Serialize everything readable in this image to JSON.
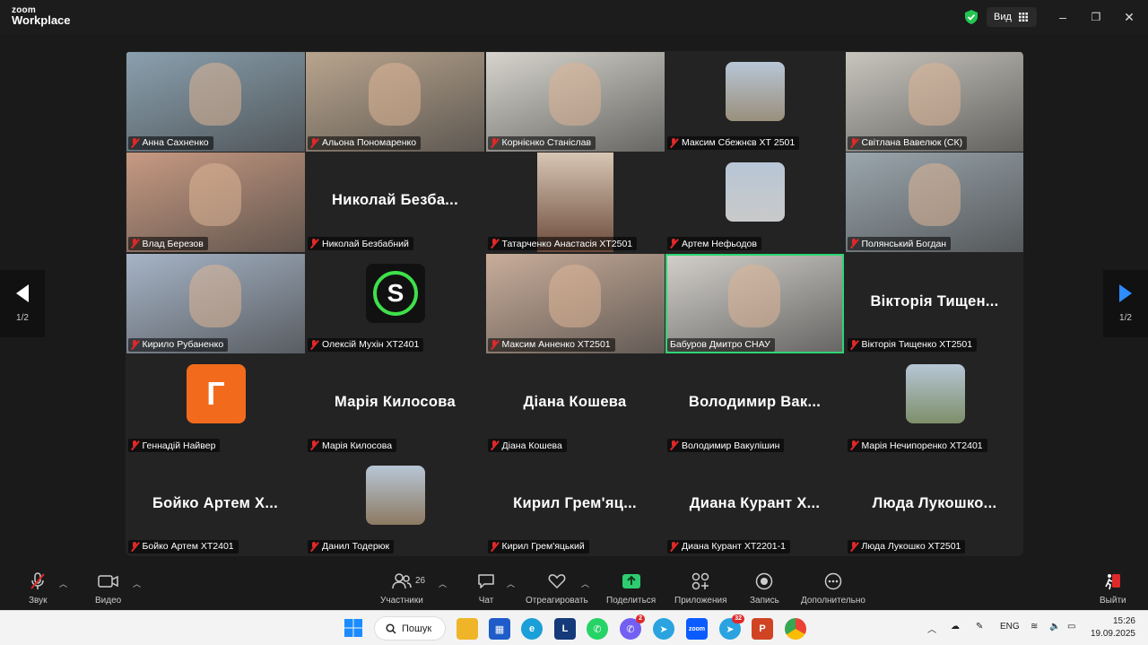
{
  "app": {
    "logo_top": "zoom",
    "logo_bottom": "Workplace",
    "view_label": "Вид"
  },
  "pager": {
    "left": "1/2",
    "right": "1/2"
  },
  "tiles": [
    {
      "name": "Анна Сахненко",
      "kind": "video",
      "bg": "#8aa0ae"
    },
    {
      "name": "Альона Пономаренко",
      "kind": "video",
      "bg": "#b9a58e"
    },
    {
      "name": "Корнієнко Станіслав",
      "kind": "video",
      "bg": "#d6d4cc"
    },
    {
      "name": "Максим Сбежнєв ХТ 2501",
      "kind": "avatar",
      "bg": "#9a8f7c"
    },
    {
      "name": "Світлана Вавелюк (СК)",
      "kind": "video",
      "bg": "#c8c5bd"
    },
    {
      "name": "Влад Березов",
      "kind": "video",
      "bg": "#c79a82"
    },
    {
      "name": "Николай Безбабний",
      "kind": "text",
      "big": "Николай Безба..."
    },
    {
      "name": "Татарченко Анастасія ХТ2501",
      "kind": "portrait",
      "bg": "#d8c6b4"
    },
    {
      "name": "Артем Нефьодов",
      "kind": "avatar",
      "bg": "#c9c9c9"
    },
    {
      "name": "Полянський Богдан",
      "kind": "video",
      "bg": "#9aa6ad"
    },
    {
      "name": "Кирило Рубаненко",
      "kind": "video",
      "bg": "#a6b4c6"
    },
    {
      "name": "Олексій Мухін ХТ2401",
      "kind": "avatar",
      "bg": "#111111",
      "letter": "S"
    },
    {
      "name": "Максим Анненко ХТ2501",
      "kind": "video",
      "bg": "#c9ad9a"
    },
    {
      "name": "Бабуров Дмитро СНАУ",
      "kind": "video",
      "bg": "#d3d0cb",
      "active": true,
      "muted": false
    },
    {
      "name": "Вікторія Тищенко ХТ2501",
      "kind": "text",
      "big": "Вікторія Тищен..."
    },
    {
      "name": "Геннадій Найвер",
      "kind": "avatar",
      "bg": "#f26b1d",
      "letter": "Г"
    },
    {
      "name": "Марія Килосова",
      "kind": "text",
      "big": "Марія Килосова"
    },
    {
      "name": "Діана Кошева",
      "kind": "text",
      "big": "Діана Кошева"
    },
    {
      "name": "Володимир Вакулішин",
      "kind": "text",
      "big": "Володимир Вак..."
    },
    {
      "name": "Марія Нечипоренко ХТ2401",
      "kind": "avatar",
      "bg": "#7d8f6a"
    },
    {
      "name": "Бойко Артем ХТ2401",
      "kind": "text",
      "big": "Бойко Артем Х..."
    },
    {
      "name": "Данил Тодерюк",
      "kind": "avatar",
      "bg": "#8d7a62"
    },
    {
      "name": "Кирил Грем'яцький",
      "kind": "text",
      "big": "Кирил Грем'яц..."
    },
    {
      "name": "Диана Курант ХТ2201-1",
      "kind": "text",
      "big": "Диана Курант Х..."
    },
    {
      "name": "Люда Лукошко ХТ2501",
      "kind": "text",
      "big": "Люда Лукошко..."
    }
  ],
  "toolbar": {
    "audio": "Звук",
    "video": "Видео",
    "participants": "Участники",
    "participants_count": "26",
    "chat": "Чат",
    "react": "Отреагировать",
    "share": "Поделиться",
    "apps": "Приложения",
    "record": "Запись",
    "more": "Дополнительно",
    "leave": "Выйти"
  },
  "taskbar": {
    "search": "Пошук",
    "lang": "ENG",
    "time": "15:26",
    "date": "19.09.2025",
    "viber_badge": "2",
    "telegram_badge": "32"
  },
  "colors": {
    "accent": "#2d8cff",
    "active_speaker": "#2ed573",
    "muted": "#e02828",
    "share": "#2ecc71"
  }
}
